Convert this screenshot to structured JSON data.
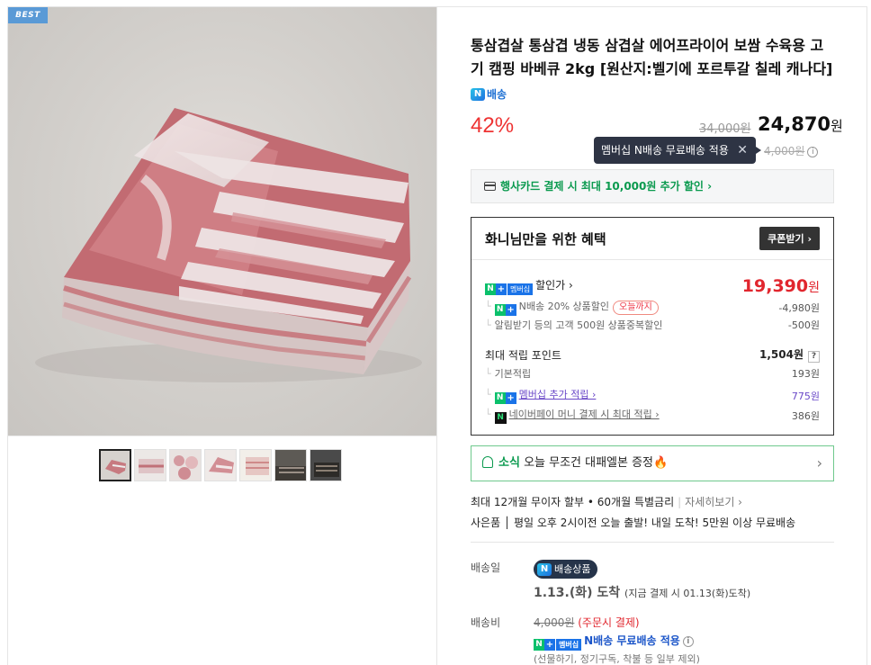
{
  "gallery": {
    "badge": "BEST",
    "thumb_count": 7
  },
  "product": {
    "title": "통삼겹살 통삼겹 냉동 삼겹살 에어프라이어 보쌈 수육용 고기 캠핑 바베큐 2kg [원산지:벨기에 포르투갈 칠레 캐나다]",
    "nbadge_text": "배송",
    "discount": "42%",
    "original_price": "34,000원",
    "sale_price": "24,870",
    "won": "원"
  },
  "tooltip": {
    "text": "멤버십 N배송 무료배송 적용",
    "close": "✕"
  },
  "ship_small": {
    "prefix": "⇨",
    "price": "4,000원"
  },
  "card_promo": "행사카드 결제 시 최대 10,000원 추가 할인 ›",
  "benefit": {
    "title": "화니님만을 위한 혜택",
    "coupon_button": "쿠폰받기 ›",
    "discount_price_label": "할인가 ›",
    "discount_price": "19,390",
    "won": "원",
    "n_delivery_text": "N배송 20% 상품할인",
    "today_tag": "오늘까지",
    "n_delivery_value": "-4,980원",
    "alarm_text": "알림받기 등의 고객 500원 상품중복할인",
    "alarm_value": "-500원",
    "points_label": "최대 적립 포인트",
    "points_value": "1,504원",
    "points_q": "?",
    "basic_label": "기본적립",
    "basic_value": "193원",
    "member_label": "멤버십 추가 적립 ›",
    "member_value": "775원",
    "npay_label": "네이버페이 머니 결제 시 최대 적립 ›",
    "npay_value": "386원",
    "member_badge": "멤버십"
  },
  "news": {
    "tag": "소식",
    "text": "오늘 무조건 대패엘본 증정🔥",
    "chevron": "›"
  },
  "installment": {
    "text": "최대 12개월 무이자 할부 • 60개월 특별금리",
    "more": "자세히보기 ›"
  },
  "gift_line": "사은품 │ 평일 오후 2시이전 오늘 출발! 내일 도착! 5만원 이상 무료배송",
  "delivery": {
    "date_label": "배송일",
    "pill_text": "배송상품",
    "arrive": "1.13.(화) 도착",
    "arrive_note": "(지금 결제 시 01.13(화)도착)",
    "fee_label": "배송비",
    "fee_original": "4,000원",
    "fee_note": "(주문시 결제)",
    "free_text": "N배송 무료배송 적용",
    "exclusion": "(선물하기, 정기구독, 착불 등 일부 제외)"
  },
  "colors": {
    "accent_red": "#e1262e",
    "npay_green": "#0ac06b",
    "naver_blue": "#1a73e8"
  }
}
